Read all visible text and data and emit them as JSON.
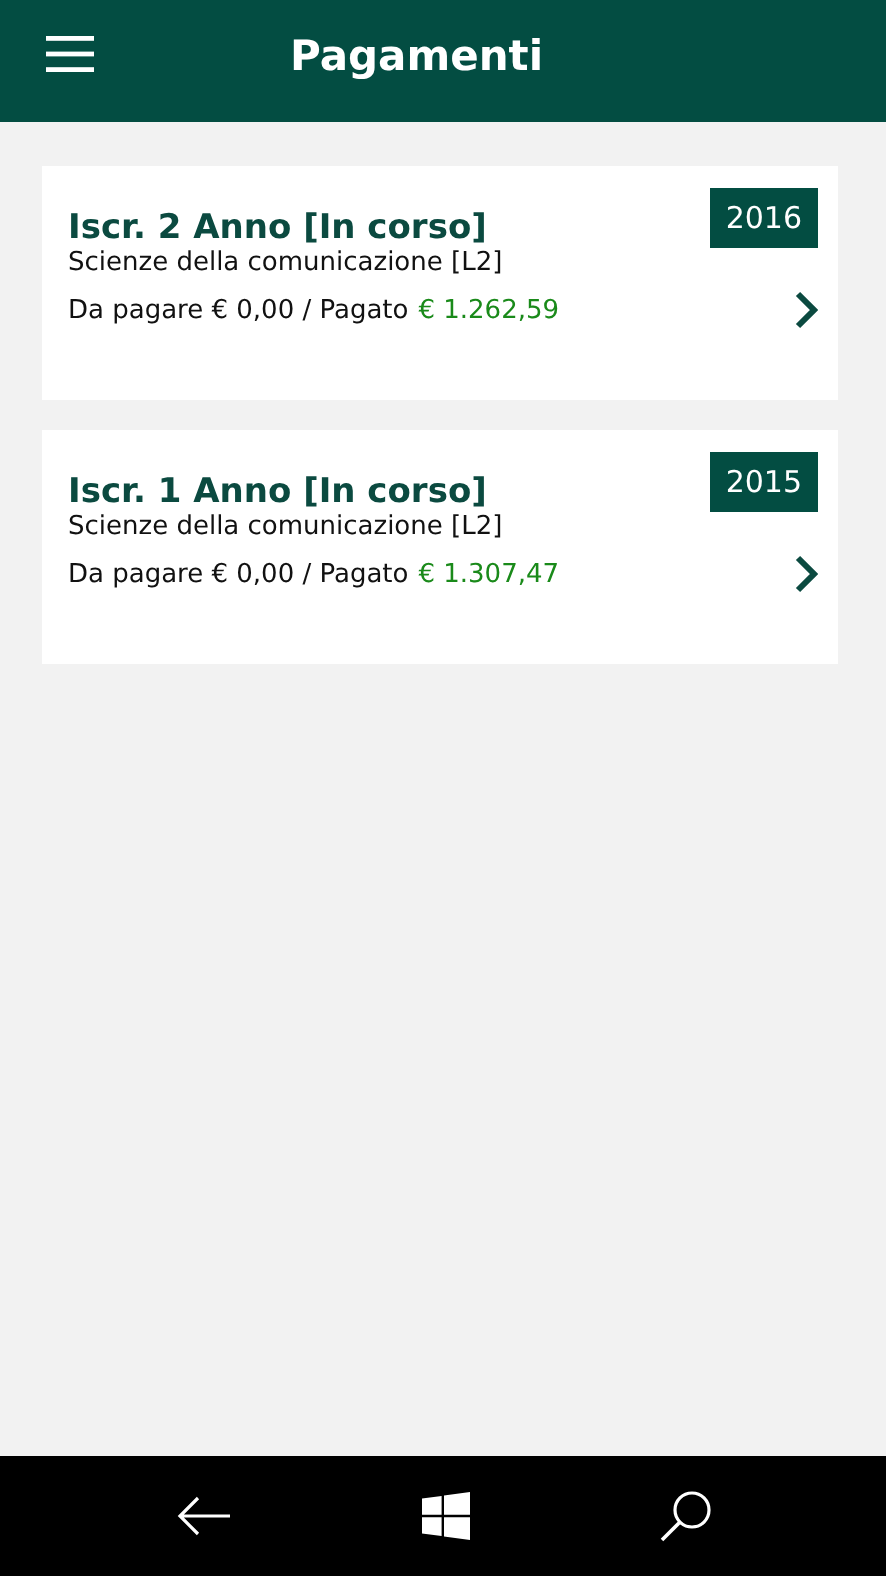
{
  "header": {
    "title": "Pagamenti"
  },
  "payments": [
    {
      "title": "Iscr. 2 Anno [In corso]",
      "course": "Scienze della comunicazione [L2]",
      "due": "Da pagare € 0,00 / Pagato",
      "paid": "€ 1.262,59",
      "year": "2016"
    },
    {
      "title": "Iscr. 1 Anno [In corso]",
      "course": "Scienze della comunicazione [L2]",
      "due": "Da pagare € 0,00 / Pagato",
      "paid": "€ 1.307,47",
      "year": "2015"
    }
  ]
}
